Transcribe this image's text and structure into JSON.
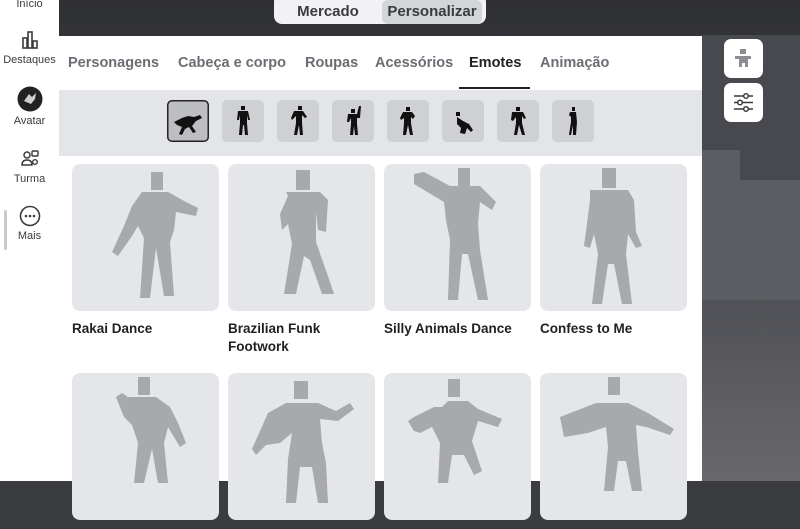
{
  "nav": {
    "items": [
      {
        "label": "Início",
        "icon": "home-icon"
      },
      {
        "label": "Destaques",
        "icon": "charts-icon"
      },
      {
        "label": "Avatar",
        "icon": "avatar-icon"
      },
      {
        "label": "Turma",
        "icon": "friends-icon"
      },
      {
        "label": "Mais",
        "icon": "more-icon"
      }
    ]
  },
  "toggle": {
    "options": [
      "Mercado",
      "Personalizar"
    ],
    "active": "Personalizar"
  },
  "tabs": [
    {
      "label": "Personagens"
    },
    {
      "label": "Cabeça e corpo"
    },
    {
      "label": "Roupas"
    },
    {
      "label": "Acessórios"
    },
    {
      "label": "Emotes"
    },
    {
      "label": "Animação"
    }
  ],
  "active_tab": "Emotes",
  "emote_slots": {
    "count_shown": 8,
    "selected_index": 0,
    "icons": [
      "pose-lying-icon",
      "pose-standing-icon",
      "pose-lean-icon",
      "pose-arm-up-icon",
      "pose-fist-icon",
      "pose-crouch-icon",
      "pose-flex-icon",
      "pose-side-icon"
    ]
  },
  "items": [
    {
      "name": "Rakai Dance"
    },
    {
      "name": "Brazilian Funk Footwork"
    },
    {
      "name": "Silly Animals Dance"
    },
    {
      "name": "Confess to Me"
    },
    {
      "name": ""
    },
    {
      "name": ""
    },
    {
      "name": ""
    },
    {
      "name": ""
    }
  ],
  "right_buttons": [
    {
      "icon": "avatar-preview-icon"
    },
    {
      "icon": "sliders-icon"
    }
  ],
  "colors": {
    "panel": "#ffffff",
    "subbar": "#e4e5e9",
    "card": "#e5e6ea",
    "figure": "#a8a9ad",
    "text_active": "#1f2023",
    "text_inactive": "#6b6d72"
  }
}
